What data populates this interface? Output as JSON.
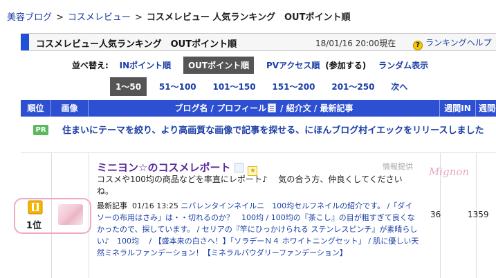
{
  "breadcrumb": {
    "items": [
      "美容ブログ",
      "コスメレビュー",
      "コスメレビュー 人気ランキング　OUTポイント順"
    ],
    "separator": ">"
  },
  "titlebar": {
    "title": "コスメレビュー人気ランキング　OUTポイント順",
    "date": "18/01/16 20:00現在",
    "help_label": "ランキングヘルプ",
    "help_icon": "?",
    "accent_color": "#1e50d8"
  },
  "sort": {
    "label": "並べ替え:",
    "options": [
      "INポイント順",
      "OUTポイント順",
      "PVアクセス順",
      "(参加する)",
      "ランダム表示"
    ]
  },
  "pager": {
    "items": [
      "1〜50",
      "51〜100",
      "101〜150",
      "151〜200",
      "201〜250",
      "次へ"
    ]
  },
  "table": {
    "headers": {
      "rank": "順位",
      "image": "画像",
      "blog_prefix": "ブログ名 / プロフィール",
      "blog_suffix": " / 紹介文 / 最新記事",
      "weekly_in": "週間IN",
      "weekly_out": "週間OUT"
    },
    "header_color": "#2d4fd2"
  },
  "pr": {
    "badge": "PR",
    "text": "住まいにテーマを絞り、より高画質な画像で記事を探せる、にほんブログ村イエックをリリースしました"
  },
  "entry": {
    "rank": "1位",
    "blog_title": "ミニヨン☆のコスメレポート",
    "info_label": "情報提供",
    "logo_text": "Mignon",
    "description": "コスメや100均の商品などを率直にレポート♪　 気の合う方、仲良くしてくださいね。",
    "recent_label": "最新記事",
    "recent_date": "01/16 13:25",
    "recent_articles": "ニバレンタインネイルニ　100均セルフネイルの紹介です。 /「ダイソーの布用はさみ」は・・切れるのか？　100均 / 100均の『茶こし』の目が粗すぎて良くなかったので、探しています。 / セリアの『竿にひっかけられる ステンレスピンチ』が素晴らしい♪　100均　 / 【盛本来の白さへ！】「ソラデーＮ４ ホワイトニングセット」 / 肌に優しい天然ミネラルファンデーション！【ミネラルパウダリーファンデーション】",
    "weekly_in": "36",
    "weekly_out": "1359",
    "highlight_color": "#f2a8c2",
    "title_color": "#5a2a9a"
  }
}
